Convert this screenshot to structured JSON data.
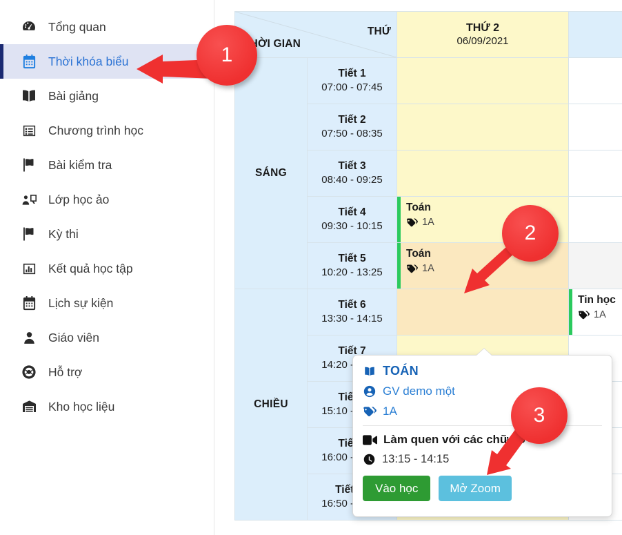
{
  "sidebar": {
    "items": [
      {
        "id": "tong-quan",
        "label": "Tổng quan",
        "icon": "dashboard-icon",
        "active": false
      },
      {
        "id": "thoi-khoa-bieu",
        "label": "Thời khóa biểu",
        "icon": "calendar-icon",
        "active": true
      },
      {
        "id": "bai-giang",
        "label": "Bài giảng",
        "icon": "book-icon",
        "active": false
      },
      {
        "id": "chuong-trinh",
        "label": "Chương trình học",
        "icon": "list-icon",
        "active": false
      },
      {
        "id": "bai-kiem-tra",
        "label": "Bài kiểm tra",
        "icon": "flag-icon",
        "active": false
      },
      {
        "id": "lop-hoc-ao",
        "label": "Lớp học ảo",
        "icon": "virtual-class-icon",
        "active": false
      },
      {
        "id": "ky-thi",
        "label": "Kỳ thi",
        "icon": "flag-icon",
        "active": false
      },
      {
        "id": "ket-qua",
        "label": "Kết quả học tập",
        "icon": "bar-chart-icon",
        "active": false
      },
      {
        "id": "lich-su-kien",
        "label": "Lịch sự kiện",
        "icon": "calendar-icon",
        "active": false
      },
      {
        "id": "giao-vien",
        "label": "Giáo viên",
        "icon": "user-icon",
        "active": false
      },
      {
        "id": "ho-tro",
        "label": "Hỗ trợ",
        "icon": "lifebuoy-icon",
        "active": false
      },
      {
        "id": "kho-hoc-lieu",
        "label": "Kho học liệu",
        "icon": "warehouse-icon",
        "active": false
      }
    ]
  },
  "schedule": {
    "corner": {
      "time_label": "THỜI GIAN",
      "day_label": "THỨ"
    },
    "days": [
      {
        "name": "THỨ 2",
        "date": "06/09/2021",
        "highlight": true
      },
      {
        "name": "",
        "date": "",
        "highlight": false
      }
    ],
    "sessions": [
      {
        "name": "SÁNG",
        "rows": 5
      },
      {
        "name": "CHIỀU",
        "rows": 5
      }
    ],
    "periods": [
      {
        "name": "Tiết 1",
        "time": "07:00 - 07:45"
      },
      {
        "name": "Tiết 2",
        "time": "07:50 - 08:35"
      },
      {
        "name": "Tiết 3",
        "time": "08:40 - 09:25"
      },
      {
        "name": "Tiết 4",
        "time": "09:30 - 10:15"
      },
      {
        "name": "Tiết 5",
        "time": "10:20 - 13:25"
      },
      {
        "name": "Tiết 6",
        "time": "13:30 - 14:15"
      },
      {
        "name": "Tiết 7",
        "time": "14:20 - 15:05"
      },
      {
        "name": "Tiết 8",
        "time": "15:10 - 15:55"
      },
      {
        "name": "Tiết 9",
        "time": "16:00 - 16:45"
      },
      {
        "name": "Tiết 10",
        "time": "16:50 - 17:35"
      }
    ],
    "events_day1": [
      null,
      null,
      null,
      {
        "subject": "Toán",
        "tag": "1A"
      },
      {
        "subject": "Toán",
        "tag": "1A"
      },
      null,
      null,
      null,
      null,
      null
    ],
    "events_day2": [
      null,
      null,
      null,
      null,
      null,
      {
        "subject": "Tin học",
        "tag": "1A"
      },
      null,
      null,
      null,
      null
    ],
    "colors": {
      "day_highlight": "#fdf8c9",
      "day_selected": "#fbe8bf",
      "header_blue": "#dceefb",
      "event_accent": "#2bca5e"
    }
  },
  "popover": {
    "subject": "TOÁN",
    "teacher": "GV demo một",
    "class_tag": "1A",
    "lesson": "Làm quen với các chữ số",
    "time": "13:15 - 14:15",
    "join_label": "Vào học",
    "zoom_label": "Mở Zoom",
    "join_color": "#2e9b33",
    "zoom_color": "#5cc0de"
  },
  "annotations": {
    "badges": [
      {
        "number": "1"
      },
      {
        "number": "2"
      },
      {
        "number": "3"
      }
    ],
    "color": "#ef3030"
  }
}
